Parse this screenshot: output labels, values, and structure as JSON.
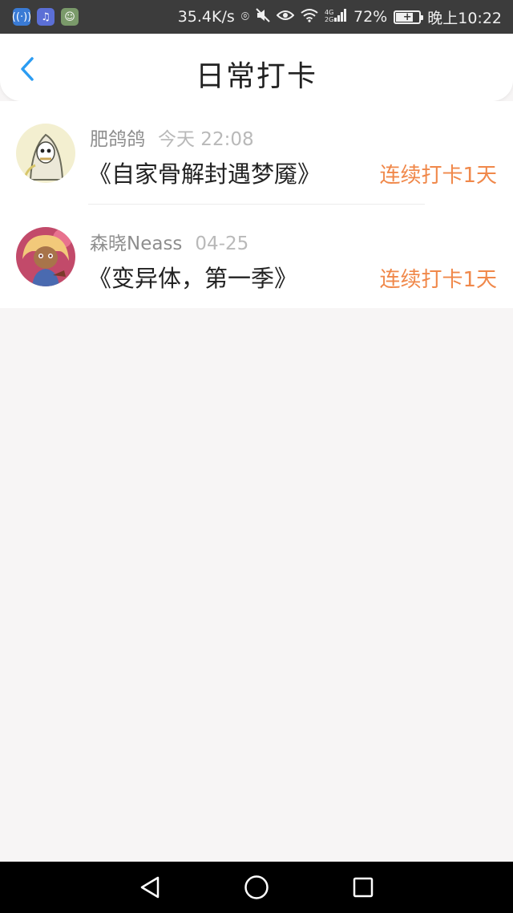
{
  "status_bar": {
    "net_speed": "35.4K/s",
    "battery_percent": "72%",
    "time": "晚上10:22",
    "icons": [
      "location-icon",
      "mute-icon",
      "eye-icon",
      "wifi-icon",
      "signal-icon",
      "battery-icon"
    ]
  },
  "header": {
    "title": "日常打卡",
    "back_icon": "chevron-left-icon",
    "accent": "#2b9cf2"
  },
  "items": [
    {
      "user": "肥鸽鸽",
      "time": "今天 22:08",
      "title": "《自家骨解封遇梦魇》",
      "streak": "连续打卡1天"
    },
    {
      "user": "森晓Neass",
      "time": "04-25",
      "title": "《变异体，第一季》",
      "streak": "连续打卡1天"
    }
  ],
  "colors": {
    "streak": "#f0884a",
    "background": "#f7f5f5"
  }
}
